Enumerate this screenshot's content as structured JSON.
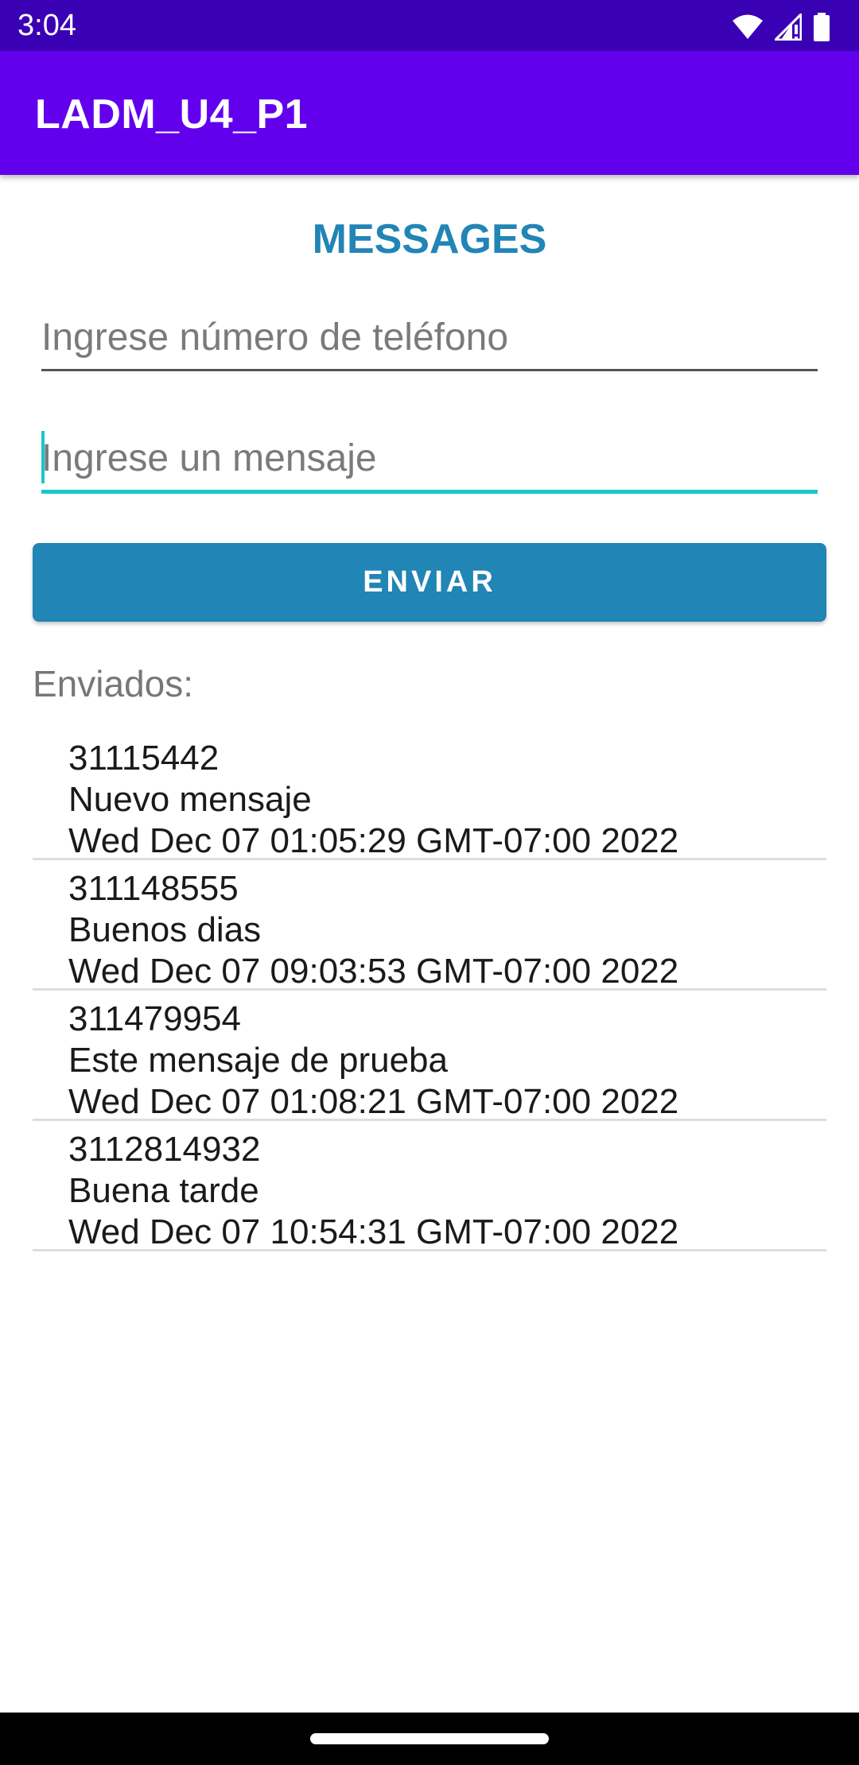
{
  "status_bar": {
    "time": "3:04",
    "icons": [
      "wifi-icon",
      "cellular-signal-icon",
      "battery-icon"
    ]
  },
  "app_bar": {
    "title": "LADM_U4_P1"
  },
  "main": {
    "heading": "MESSAGES",
    "phone_input": {
      "value": "",
      "placeholder": "Ingrese número de teléfono"
    },
    "message_input": {
      "value": "",
      "placeholder": "Ingrese un mensaje"
    },
    "send_label": "ENVIAR",
    "sent_label": "Enviados:",
    "sent_items": [
      {
        "number": "31115442",
        "message": "Nuevo mensaje",
        "date": "Wed Dec 07 01:05:29 GMT-07:00 2022"
      },
      {
        "number": "311148555",
        "message": "Buenos dias",
        "date": "Wed Dec 07 09:03:53 GMT-07:00 2022"
      },
      {
        "number": "311479954",
        "message": "Este mensaje de prueba",
        "date": "Wed Dec 07 01:08:21 GMT-07:00 2022"
      },
      {
        "number": "3112814932",
        "message": "Buena tarde",
        "date": "Wed Dec 07 10:54:31 GMT-07:00 2022"
      }
    ]
  },
  "colors": {
    "status_bar": "#3a00b4",
    "app_bar": "#6200ee",
    "accent": "#2185b5",
    "focus": "#17c8c8"
  }
}
